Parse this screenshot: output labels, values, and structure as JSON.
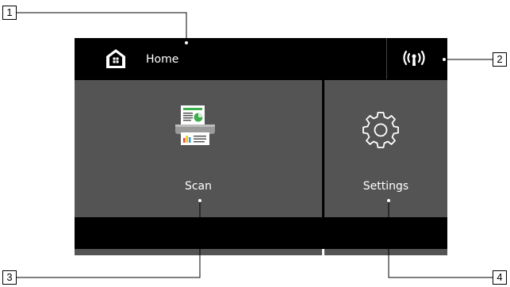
{
  "callouts": [
    "1",
    "2",
    "3",
    "4"
  ],
  "header": {
    "title": "Home"
  },
  "tiles": [
    {
      "label": "Scan",
      "icon": "scanner-icon"
    },
    {
      "label": "Settings",
      "icon": "gear-icon"
    }
  ],
  "status_icons": {
    "wireless": "wireless-signal-icon"
  },
  "colors": {
    "screen_background": "#000000",
    "tile_background": "#545454",
    "text": "#ffffff",
    "scan_icon_green": "#3cae4a"
  }
}
